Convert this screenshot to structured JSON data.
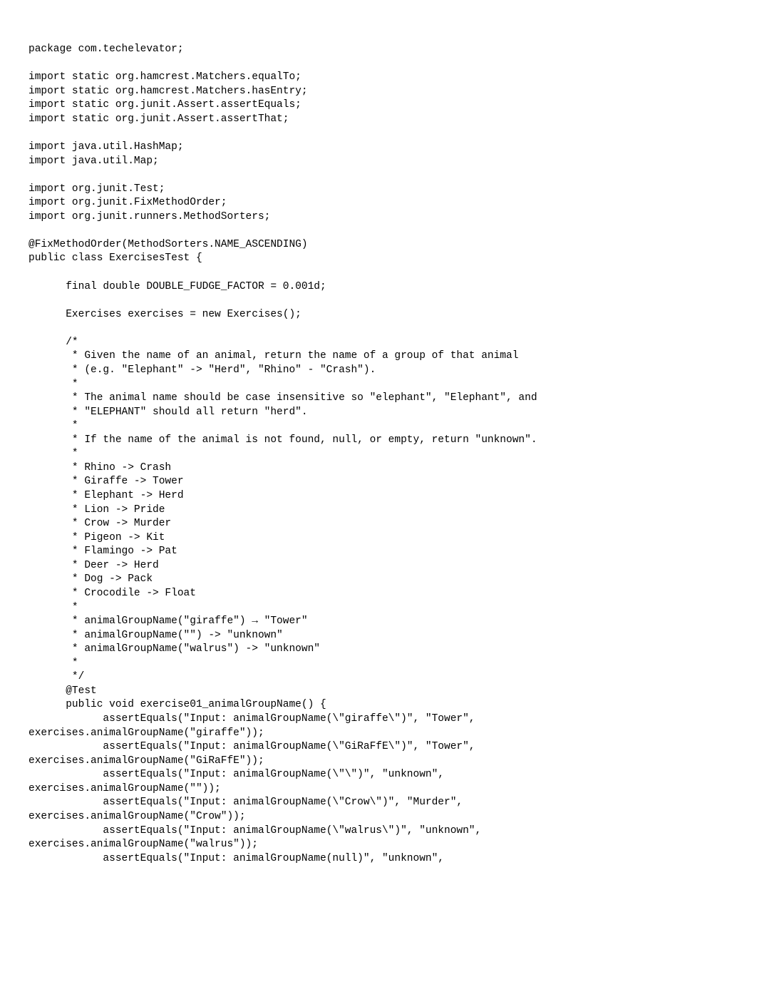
{
  "code": "package com.techelevator;\n\nimport static org.hamcrest.Matchers.equalTo;\nimport static org.hamcrest.Matchers.hasEntry;\nimport static org.junit.Assert.assertEquals;\nimport static org.junit.Assert.assertThat;\n\nimport java.util.HashMap;\nimport java.util.Map;\n\nimport org.junit.Test;\nimport org.junit.FixMethodOrder;\nimport org.junit.runners.MethodSorters;\n\n@FixMethodOrder(MethodSorters.NAME_ASCENDING)\npublic class ExercisesTest {\n\n      final double DOUBLE_FUDGE_FACTOR = 0.001d;\n\n      Exercises exercises = new Exercises();\n\n      /*\n       * Given the name of an animal, return the name of a group of that animal\n       * (e.g. \"Elephant\" -> \"Herd\", \"Rhino\" - \"Crash\").\n       *\n       * The animal name should be case insensitive so \"elephant\", \"Elephant\", and\n       * \"ELEPHANT\" should all return \"herd\".\n       *\n       * If the name of the animal is not found, null, or empty, return \"unknown\".\n       *\n       * Rhino -> Crash\n       * Giraffe -> Tower\n       * Elephant -> Herd\n       * Lion -> Pride\n       * Crow -> Murder\n       * Pigeon -> Kit\n       * Flamingo -> Pat\n       * Deer -> Herd\n       * Dog -> Pack\n       * Crocodile -> Float\n       *\n       * animalGroupName(\"giraffe\") → \"Tower\"\n       * animalGroupName(\"\") -> \"unknown\"\n       * animalGroupName(\"walrus\") -> \"unknown\"\n       *\n       */\n      @Test\n      public void exercise01_animalGroupName() {\n            assertEquals(\"Input: animalGroupName(\\\"giraffe\\\")\", \"Tower\",\nexercises.animalGroupName(\"giraffe\"));\n            assertEquals(\"Input: animalGroupName(\\\"GiRaFfE\\\")\", \"Tower\",\nexercises.animalGroupName(\"GiRaFfE\"));\n            assertEquals(\"Input: animalGroupName(\\\"\\\")\", \"unknown\",\nexercises.animalGroupName(\"\"));\n            assertEquals(\"Input: animalGroupName(\\\"Crow\\\")\", \"Murder\",\nexercises.animalGroupName(\"Crow\"));\n            assertEquals(\"Input: animalGroupName(\\\"walrus\\\")\", \"unknown\",\nexercises.animalGroupName(\"walrus\"));\n            assertEquals(\"Input: animalGroupName(null)\", \"unknown\","
}
